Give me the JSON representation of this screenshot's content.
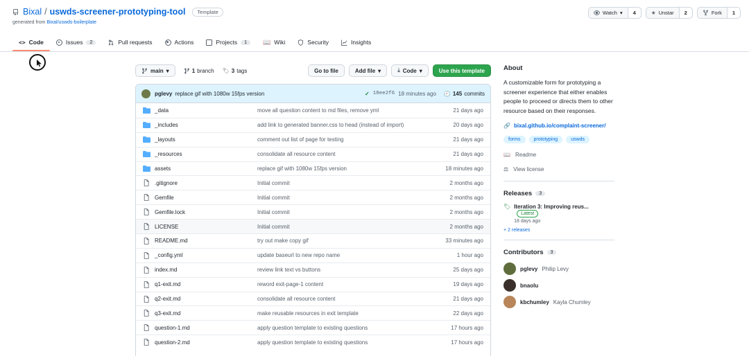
{
  "repo": {
    "owner": "Bixal",
    "separator": "/",
    "name": "uswds-screener-prototyping-tool",
    "badge": "Template",
    "generated_prefix": "generated from",
    "generated_link": "Bixal/uswds-boilerplate"
  },
  "actions": {
    "watch": {
      "label": "Watch",
      "count": "4"
    },
    "unstar": {
      "label": "Unstar",
      "count": "2"
    },
    "fork": {
      "label": "Fork",
      "count": "1"
    }
  },
  "tabs": [
    {
      "label": "Code",
      "icon": "code-icon"
    },
    {
      "label": "Issues",
      "count": "2",
      "icon": "issue-icon"
    },
    {
      "label": "Pull requests",
      "icon": "pull-request-icon"
    },
    {
      "label": "Actions",
      "icon": "play-icon"
    },
    {
      "label": "Projects",
      "count": "1",
      "icon": "table-icon"
    },
    {
      "label": "Wiki",
      "icon": "book-icon"
    },
    {
      "label": "Security",
      "icon": "shield-icon"
    },
    {
      "label": "Insights",
      "icon": "graph-icon"
    }
  ],
  "branch_bar": {
    "branch": "main",
    "branch_count": "1",
    "branch_word": "branch",
    "tag_count": "3",
    "tag_word": "tags",
    "goto_file": "Go to file",
    "add_file": "Add file",
    "code": "Code",
    "use_template": "Use this template"
  },
  "latest_commit": {
    "author": "pglevy",
    "message": "replace gif with 1080w 15fps version",
    "sha": "18ee2f6",
    "time": "18 minutes ago",
    "commits_count": "145",
    "commits_word": "commits"
  },
  "files": [
    {
      "type": "dir",
      "name": "_data",
      "message": "move all question content to md files, remove yml",
      "age": "21 days ago"
    },
    {
      "type": "dir",
      "name": "_includes",
      "message": "add link to generated banner.css to head (instead of import)",
      "age": "20 days ago"
    },
    {
      "type": "dir",
      "name": "_layouts",
      "message": "comment out list of page for testing",
      "age": "21 days ago"
    },
    {
      "type": "dir",
      "name": "_resources",
      "message": "consolidate all resource content",
      "age": "21 days ago"
    },
    {
      "type": "dir",
      "name": "assets",
      "message": "replace gif with 1080w 15fps version",
      "age": "18 minutes ago"
    },
    {
      "type": "file",
      "name": ".gitignore",
      "message": "Initial commit",
      "age": "2 months ago"
    },
    {
      "type": "file",
      "name": "Gemfile",
      "message": "Initial commit",
      "age": "2 months ago"
    },
    {
      "type": "file",
      "name": "Gemfile.lock",
      "message": "Initial commit",
      "age": "2 months ago"
    },
    {
      "type": "file",
      "name": "LICENSE",
      "message": "Initial commit",
      "age": "2 months ago"
    },
    {
      "type": "file",
      "name": "README.md",
      "message": "try out make copy gif",
      "age": "33 minutes ago"
    },
    {
      "type": "file",
      "name": "_config.yml",
      "message": "update baseurl to new repo name",
      "age": "1 hour ago"
    },
    {
      "type": "file",
      "name": "index.md",
      "message": "review link text vs buttons",
      "age": "25 days ago"
    },
    {
      "type": "file",
      "name": "q1-exit.md",
      "message": "reword exit-page-1 content",
      "age": "19 days ago"
    },
    {
      "type": "file",
      "name": "q2-exit.md",
      "message": "consolidate all resource content",
      "age": "21 days ago"
    },
    {
      "type": "file",
      "name": "q3-exit.md",
      "message": "make reusable resources in exit template",
      "age": "22 days ago"
    },
    {
      "type": "file",
      "name": "question-1.md",
      "message": "apply question template to existing questions",
      "age": "17 hours ago"
    },
    {
      "type": "file",
      "name": "question-2.md",
      "message": "apply question template to existing questions",
      "age": "17 hours ago"
    }
  ],
  "about": {
    "heading": "About",
    "description": "A customizable form for prototyping a screener experience that either enables people to proceed or directs them to other resource based on their responses.",
    "website": "bixal.github.io/complaint-screener/",
    "topics": [
      "forms",
      "prototyping",
      "uswds"
    ],
    "readme": "Readme",
    "license": "View license"
  },
  "releases": {
    "heading": "Releases",
    "count": "3",
    "latest_title": "Iteration 3: Improving reus...",
    "latest_badge": "Latest",
    "latest_date": "18 days ago",
    "more": "+ 2 releases"
  },
  "contributors": {
    "heading": "Contributors",
    "count": "3",
    "people": [
      {
        "login": "pglevy",
        "name": "Philip Levy"
      },
      {
        "login": "bnaolu",
        "name": ""
      },
      {
        "login": "kbchumley",
        "name": "Kayla Chumley"
      }
    ]
  },
  "colors": {
    "accent": "#0969da",
    "primary_button": "#2da44e",
    "tab_underline": "#fd8c73",
    "folder": "#54aeff"
  }
}
